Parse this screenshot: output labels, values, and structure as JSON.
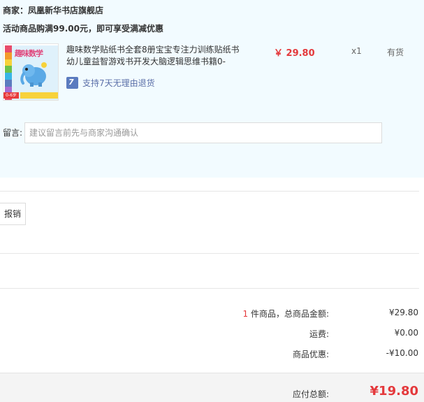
{
  "shop": {
    "merchant_label": "商家：",
    "merchant_name": "凤凰新华书店旗舰店",
    "promo_text": "活动商品购满99.00元，即可享受满减优惠"
  },
  "item": {
    "title": "趣味数学贴纸书全套8册宝宝专注力训练贴纸书幼儿童益智游戏书开发大脑逻辑思维书籍0-",
    "price": "￥ 29.80",
    "quantity": "x1",
    "stock": "有货",
    "return_badge": "7",
    "return_text": "支持7天无理由退货",
    "cover_title": "趣味数学",
    "cover_age": "0-6岁"
  },
  "message": {
    "label": "留言:",
    "placeholder": "建议留言前先与商家沟通确认"
  },
  "invoice": {
    "button_label": "报销"
  },
  "summary": {
    "count": "1",
    "items_label": " 件商品，总商品金额:",
    "items_total": "¥29.80",
    "shipping_label": "运费:",
    "shipping_value": "¥0.00",
    "discount_label": "商品优惠:",
    "discount_value": "-¥10.00",
    "total_label": "应付总额:",
    "total_value": "¥19.80"
  },
  "colors": {
    "accent_red": "#e4393c",
    "panel_bg": "#f2fbff",
    "return_badge": "#5b7bbf"
  },
  "icons": {
    "return": "seven-day-return-icon"
  }
}
